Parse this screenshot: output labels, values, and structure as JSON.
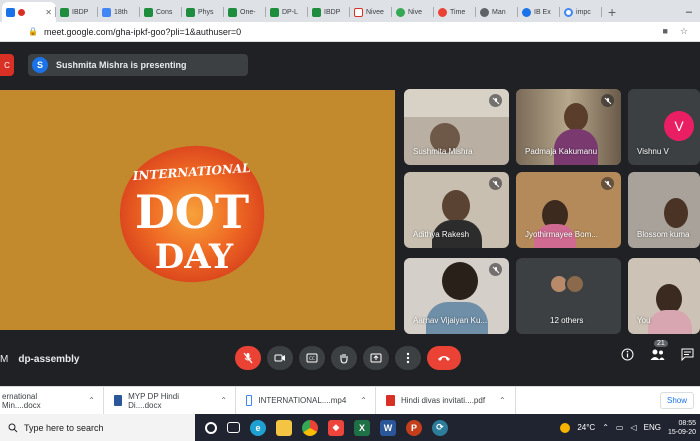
{
  "browser": {
    "tabs": [
      {
        "label": "",
        "color": "#1a73e8",
        "active": true
      },
      {
        "label": "IBDP",
        "color": "#1e8e3e"
      },
      {
        "label": "18th",
        "color": "#4285f4"
      },
      {
        "label": "Cons",
        "color": "#1e8e3e"
      },
      {
        "label": "Phys",
        "color": "#1e8e3e"
      },
      {
        "label": "One-",
        "color": "#1e8e3e"
      },
      {
        "label": "DP-L",
        "color": "#1e8e3e"
      },
      {
        "label": "IBDP",
        "color": "#1e8e3e"
      },
      {
        "label": "Nivee",
        "color": "#d93025"
      },
      {
        "label": "Nive",
        "color": "#34a853"
      },
      {
        "label": "Time",
        "color": "#ea4335"
      },
      {
        "label": "Man",
        "color": "#5f6368"
      },
      {
        "label": "IB Ex",
        "color": "#1a73e8"
      },
      {
        "label": "impc",
        "color": "#4285f4"
      }
    ],
    "new_tab": "+",
    "url": "meet.google.com/gha-ipkf-goo?pli=1&authuser=0"
  },
  "meet": {
    "presenter_initial": "S",
    "presenting_text": "Sushmita Mishra is presenting",
    "meeting_time": "M",
    "meeting_code": "dp-assembly",
    "participant_count": "21",
    "tiles": [
      {
        "name": "Sushmita Mishra",
        "muted": true
      },
      {
        "name": "Padmaja Kakumanu",
        "muted": true
      },
      {
        "name": "Vishnu V",
        "initial": "V",
        "muted": false
      },
      {
        "name": "Adithya Rakesh",
        "muted": true
      },
      {
        "name": "Jyothirmayee Bom...",
        "muted": true
      },
      {
        "name": "Blossom kuma",
        "muted": false
      },
      {
        "name": "Aarnav Vijaiyan Ku...",
        "muted": true
      },
      {
        "name": "12 others",
        "muted": false
      },
      {
        "name": "You",
        "muted": false
      }
    ]
  },
  "downloads": {
    "items": [
      {
        "label": "ernational Min....docx",
        "color": "#2b579a"
      },
      {
        "label": "MYP DP Hindi Di....docx",
        "color": "#2b579a"
      },
      {
        "label": "INTERNATIONAL....mp4",
        "color": "#4285f4"
      },
      {
        "label": "Hindi divas invitati....pdf",
        "color": "#d93025"
      }
    ],
    "show_all": "Show"
  },
  "taskbar": {
    "search_placeholder": "Type here to search",
    "temperature": "24°C",
    "language": "ENG",
    "time": "08:55",
    "date": "15-09-20"
  },
  "colors": {
    "meet_bg": "#202124",
    "stage_bg": "#c38a2d",
    "end_call": "#ea4335"
  }
}
